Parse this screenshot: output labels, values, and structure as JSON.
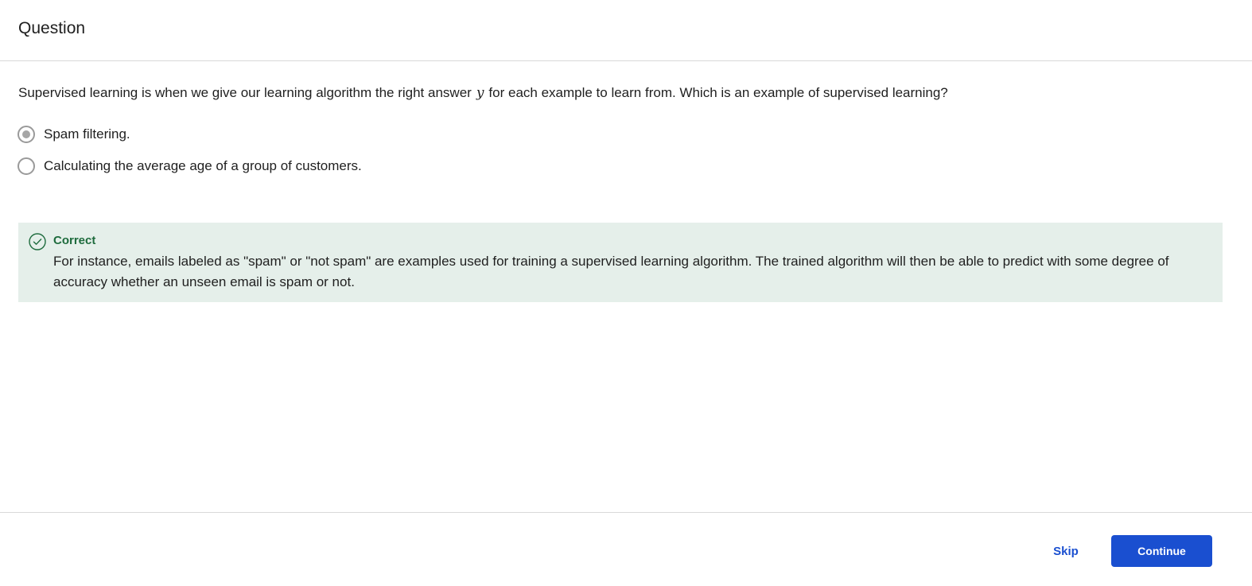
{
  "header": {
    "title": "Question"
  },
  "question": {
    "prompt_before": "Supervised learning is when we give our learning algorithm the right answer",
    "variable": "y",
    "prompt_after": "for each example to learn from.  Which is an example of supervised learning?",
    "options": [
      {
        "label": "Spam filtering.",
        "selected": true
      },
      {
        "label": "Calculating the average age of a group of customers.",
        "selected": false
      }
    ]
  },
  "feedback": {
    "status": "Correct",
    "status_color": "#1e6b3d",
    "background": "#e5efea",
    "icon": "check-circle-icon",
    "explanation": "For instance, emails labeled as \"spam\" or \"not spam\" are examples used for training a supervised learning algorithm. The trained algorithm will then be able to predict with some degree of accuracy whether an unseen email is spam or not."
  },
  "footer": {
    "skip_label": "Skip",
    "continue_label": "Continue",
    "accent": "#1a4fd0"
  }
}
